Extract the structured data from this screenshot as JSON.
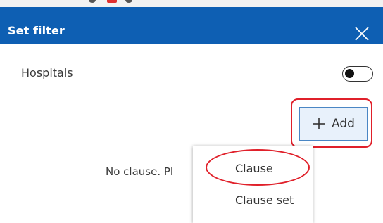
{
  "panel": {
    "title": "Set filter"
  },
  "layer_row": {
    "label": "Hospitals",
    "toggle_on": false
  },
  "toolbar": {
    "add_label": "Add"
  },
  "empty_state": {
    "message": "No clause. Pl"
  },
  "add_menu": {
    "items": [
      {
        "label": "Clause"
      },
      {
        "label": "Clause set"
      }
    ]
  },
  "icons": {
    "close": "close-icon",
    "add": "plus-icon"
  },
  "colors": {
    "header": "#0e5fb3",
    "accent_border": "#4a86c4",
    "annotation_red": "#e0202a"
  }
}
